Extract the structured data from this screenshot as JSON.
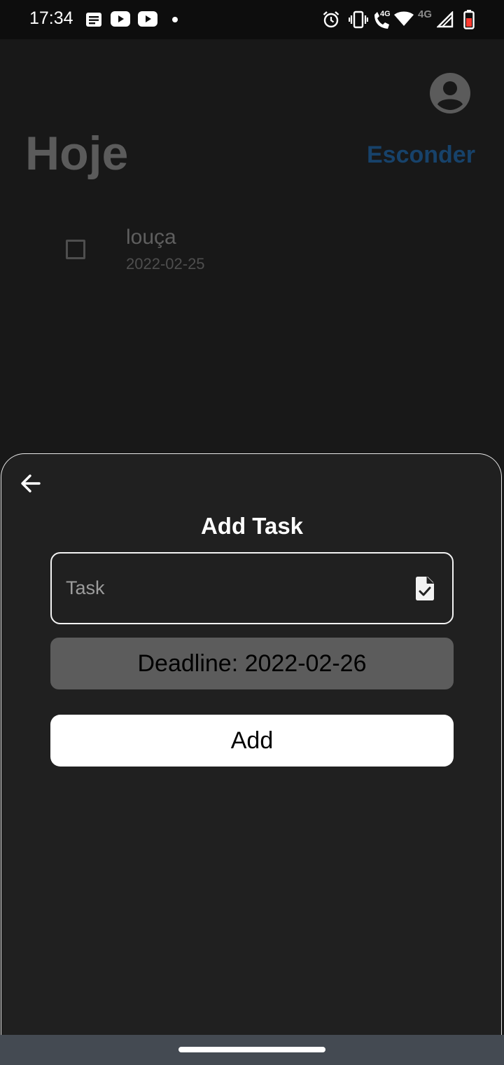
{
  "status_bar": {
    "time": "17:34",
    "left_icons": [
      "news-icon",
      "youtube-icon",
      "youtube-icon",
      "notification-dot-icon"
    ],
    "right_icons": [
      "alarm-icon",
      "vibrate-icon",
      "volte-call-icon",
      "wifi-icon",
      "signal-icon",
      "battery-icon"
    ],
    "lte_label": "4G",
    "signal_label": "4G",
    "battery_color": "#ff3b30"
  },
  "header": {
    "title": "Hoje",
    "hide_label": "Esconder",
    "avatar_icon": "account-circle-icon"
  },
  "tasks": [
    {
      "name": "louça",
      "date": "2022-02-25",
      "checked": false
    }
  ],
  "sheet": {
    "back_icon": "arrow-back-icon",
    "title": "Add Task",
    "task_input": {
      "placeholder": "Task",
      "value": "",
      "icon": "document-check-icon"
    },
    "deadline_label": "Deadline: 2022-02-26",
    "add_label": "Add"
  },
  "colors": {
    "background": "#181818",
    "sheet": "#202020",
    "accent": "#17426a",
    "deadline_button": "#5c5c5c",
    "nav_bar": "#444a52"
  }
}
